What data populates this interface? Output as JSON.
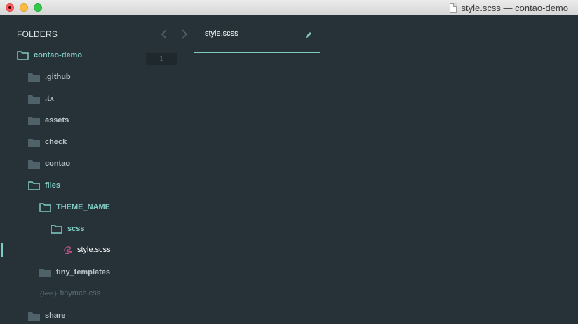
{
  "window": {
    "title": "style.scss — contao-demo"
  },
  "sidebar": {
    "header": "FOLDERS",
    "items": [
      {
        "label": "contao-demo",
        "type": "folder-open"
      },
      {
        "label": ".github",
        "type": "folder"
      },
      {
        "label": ".tx",
        "type": "folder"
      },
      {
        "label": "assets",
        "type": "folder"
      },
      {
        "label": "check",
        "type": "folder"
      },
      {
        "label": "contao",
        "type": "folder"
      },
      {
        "label": "files",
        "type": "folder-open"
      },
      {
        "label": "THEME_NAME",
        "type": "folder-open"
      },
      {
        "label": "scss",
        "type": "folder-open"
      },
      {
        "label": "style.scss",
        "type": "file-sass"
      },
      {
        "label": "tiny_templates",
        "type": "folder"
      },
      {
        "label": "tinymce.css",
        "type": "file-less",
        "icon_text": "{less}"
      },
      {
        "label": "share",
        "type": "folder"
      }
    ]
  },
  "editor": {
    "back_icon": "chevron-left-icon",
    "forward_icon": "chevron-right-icon",
    "tab": {
      "label": "style.scss",
      "icon": "pencil-icon"
    },
    "line_numbers": [
      "1"
    ]
  },
  "colors": {
    "background": "#263238",
    "accent": "#80cbc4",
    "folder_icon": "#4f626a",
    "folder_text": "#b6c4c8"
  }
}
